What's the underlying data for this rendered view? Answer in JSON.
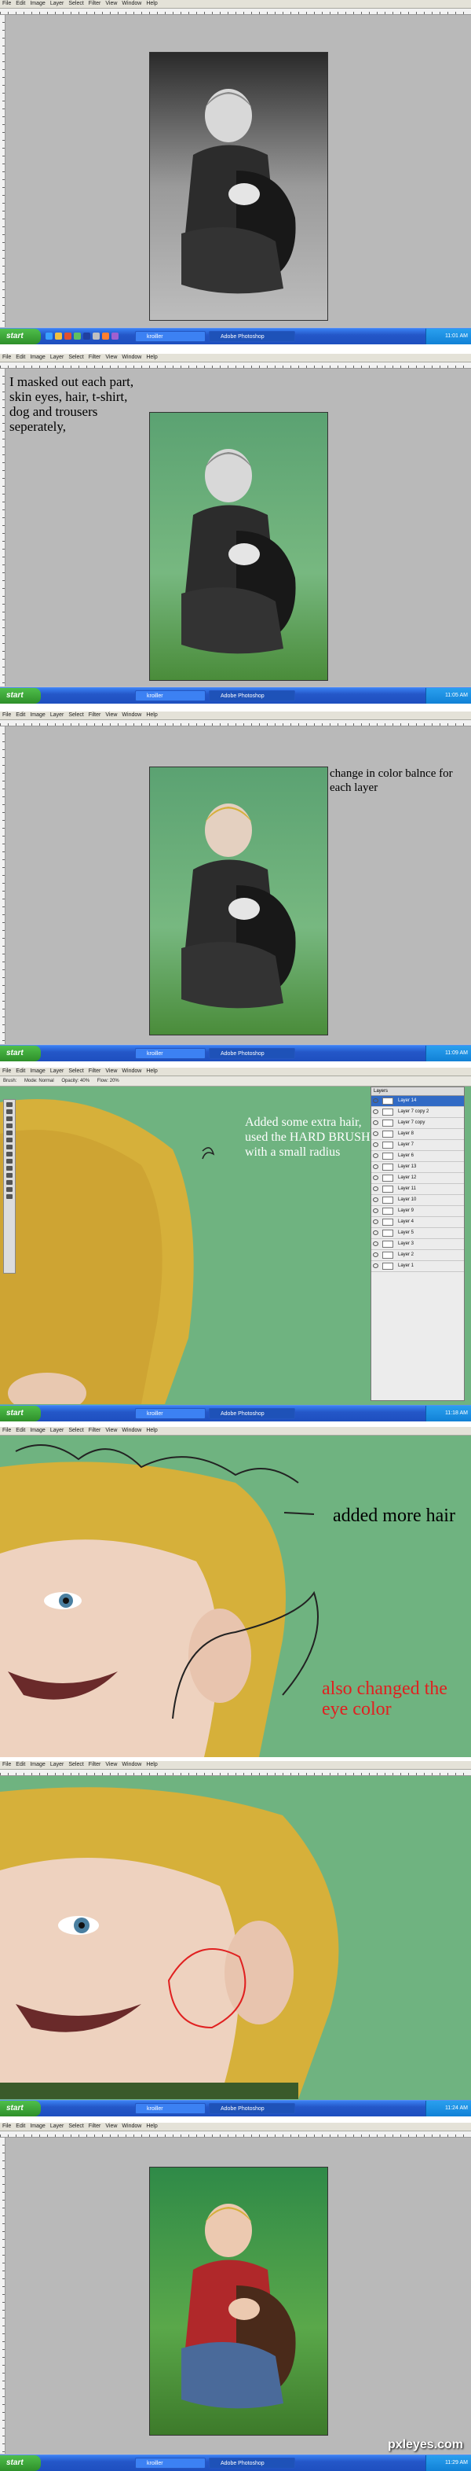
{
  "menu": [
    "File",
    "Edit",
    "Image",
    "Layer",
    "Select",
    "Filter",
    "View",
    "Window",
    "Help"
  ],
  "taskbar": {
    "start": "start",
    "btn_folder": "kroiller",
    "btn_ps": "Adobe Photoshop"
  },
  "steps": [
    {
      "time": "11:01 AM"
    },
    {
      "time": "11:05 AM",
      "note": "I masked out each part, skin eyes, hair, t-shirt, dog and trousers seperately,"
    },
    {
      "time": "11:09 AM",
      "note": "change in color balnce for each layer"
    },
    {
      "time": "11:18 AM",
      "note_line1": "Added some extra hair, used the",
      "note_highlight": "HARD BRUSH",
      "note_line2": "with a small radius",
      "options": [
        "Brush:",
        "Mode: Normal",
        "Opacity: 40%",
        "Flow: 20%"
      ],
      "layers_title": "Layers",
      "layers": [
        "Layer 14",
        "Layer 7 copy 2",
        "Layer 7 copy",
        "Layer 8",
        "Layer 7",
        "Layer 6",
        "Layer 13",
        "Layer 12",
        "Layer 11",
        "Layer 10",
        "Layer 9",
        "Layer 4",
        "Layer 5",
        "Layer 3",
        "Layer 2",
        "Layer 1"
      ]
    },
    {
      "time": "11:20 AM",
      "note_a": "added more hair",
      "note_b": "also changed the eye color"
    },
    {
      "time": "11:24 AM"
    },
    {
      "time": "11:29 AM"
    }
  ],
  "watermark": "pxleyes.com",
  "colors": {
    "gray": "#b9b9b9",
    "green": "#6fb380",
    "hair": "#d6b03a",
    "red_text": "#e02020",
    "highlight": "#ffffff"
  }
}
